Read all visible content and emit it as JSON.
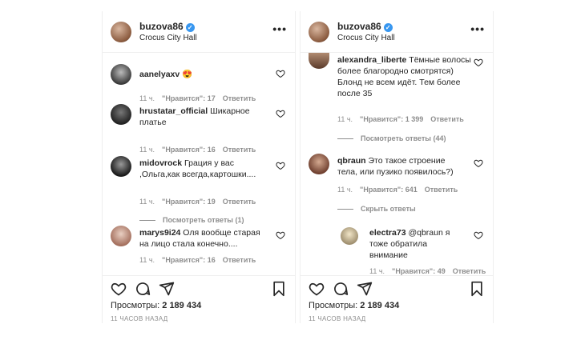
{
  "left": {
    "header": {
      "username": "buzova86",
      "location": "Crocus City Hall",
      "more": "•••"
    },
    "comments": [
      {
        "user": "aanelyaxv",
        "text": " 😍",
        "time": "11 ч.",
        "likes": "\"Нравится\": 17",
        "reply": "Ответить"
      },
      {
        "user": "hrustatar_official",
        "text": " Шикарное платье",
        "time": "11 ч.",
        "likes": "\"Нравится\": 16",
        "reply": "Ответить"
      },
      {
        "user": "midovrock",
        "text": " Грация у вас ,Ольга,как всегда,картошки....",
        "time": "11 ч.",
        "likes": "\"Нравится\": 19",
        "reply": "Ответить",
        "replies": "Посмотреть ответы (1)"
      },
      {
        "user": "marys9i24",
        "text": " Оля вообще старая на лицо стала конечно....",
        "time": "11 ч.",
        "likes": "\"Нравится\": 16",
        "reply": "Ответить"
      }
    ],
    "views_label": "Просмотры:",
    "views_value": "2 189 434",
    "ago": "11 ЧАСОВ НАЗАД"
  },
  "right": {
    "header": {
      "username": "buzova86",
      "location": "Crocus City Hall",
      "more": "•••"
    },
    "comments": [
      {
        "user": "alexandra_liberte",
        "text": " Тёмные волосы более благородно смотрятся) Блонд не всем идёт. Тем более после 35",
        "time": "11 ч.",
        "likes": "\"Нравится\": 1 399",
        "reply": "Ответить",
        "replies": "Посмотреть ответы (44)"
      },
      {
        "user": "qbraun",
        "text": " Это такое строение тела, или пузико появилось?)",
        "time": "11 ч.",
        "likes": "\"Нравится\": 641",
        "reply": "Ответить",
        "replies": "Скрыть ответы"
      },
      {
        "user": "electra73",
        "text": " @qbraun я тоже обратила внимание",
        "time": "11 ч.",
        "likes": "\"Нравится\": 49",
        "reply": "Ответить"
      }
    ],
    "views_label": "Просмотры:",
    "views_value": "2 189 434",
    "ago": "11 ЧАСОВ НАЗАД"
  },
  "icons": {
    "verified": "verified-badge-icon",
    "heart": "heart-outline-icon",
    "comment": "comment-bubble-icon",
    "share": "paper-plane-icon",
    "save": "bookmark-icon"
  }
}
